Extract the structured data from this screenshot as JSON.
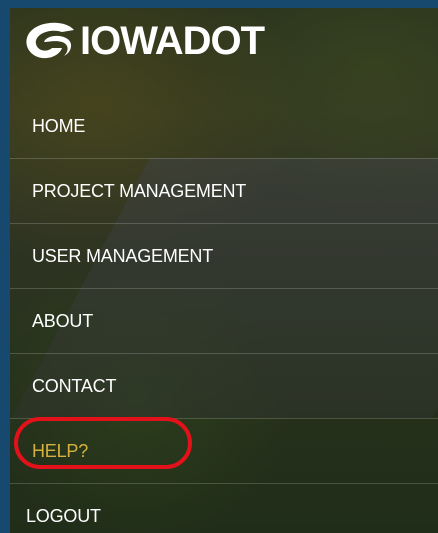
{
  "brand": {
    "name": "IOWADOT",
    "icon": "iowadot-logo-icon"
  },
  "nav": {
    "items": [
      {
        "label": "HOME"
      },
      {
        "label": "PROJECT MANAGEMENT"
      },
      {
        "label": "USER MANAGEMENT"
      },
      {
        "label": "ABOUT"
      },
      {
        "label": "CONTACT"
      },
      {
        "label": "HELP?"
      },
      {
        "label": "LOGOUT"
      }
    ]
  },
  "colors": {
    "background": "#17496e",
    "text": "#ffffff",
    "active_item": "#d7b13f",
    "highlight_circle": "#e3121a"
  }
}
